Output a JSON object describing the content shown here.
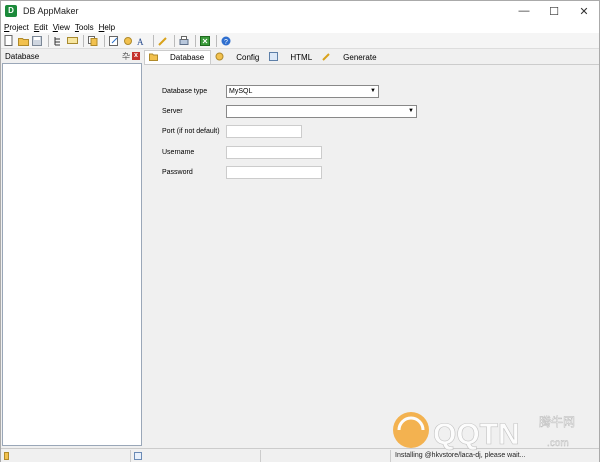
{
  "window": {
    "title": "DB AppMaker",
    "minimize": "—",
    "maximize": "☐",
    "close": "✕"
  },
  "menu": [
    {
      "accel": "P",
      "rest": "roject"
    },
    {
      "accel": "E",
      "rest": "dit"
    },
    {
      "accel": "V",
      "rest": "iew"
    },
    {
      "accel": "T",
      "rest": "ools"
    },
    {
      "accel": "H",
      "rest": "elp"
    }
  ],
  "toolbar": {
    "icons": [
      "new-file-icon",
      "open-folder-icon",
      "save-icon",
      "tree-icon",
      "comment-icon",
      "copy-icon",
      "edit-icon",
      "refresh-icon",
      "font-icon",
      "wand-icon",
      "print-icon",
      "export-icon",
      "help-icon"
    ]
  },
  "left_panel": {
    "title": "Database",
    "pin": "卆",
    "close": "x"
  },
  "tabs": [
    {
      "label": "Database",
      "active": true
    },
    {
      "label": "Config",
      "active": false
    },
    {
      "label": "HTML",
      "active": false
    },
    {
      "label": "Generate",
      "active": false
    }
  ],
  "form": {
    "db_type_label": "Database type",
    "db_type_value": "MySQL",
    "server_label": "Server",
    "server_value": "",
    "port_label": "Port (if not default)",
    "port_value": "",
    "username_label": "Username",
    "username_value": "",
    "password_label": "Password",
    "password_value": ""
  },
  "status": {
    "text": "Installing @hkvstore/laca-dj, please wait..."
  },
  "watermark": {
    "brand": "QQTN",
    "suffix": ".com",
    "cn": "腾牛网"
  }
}
